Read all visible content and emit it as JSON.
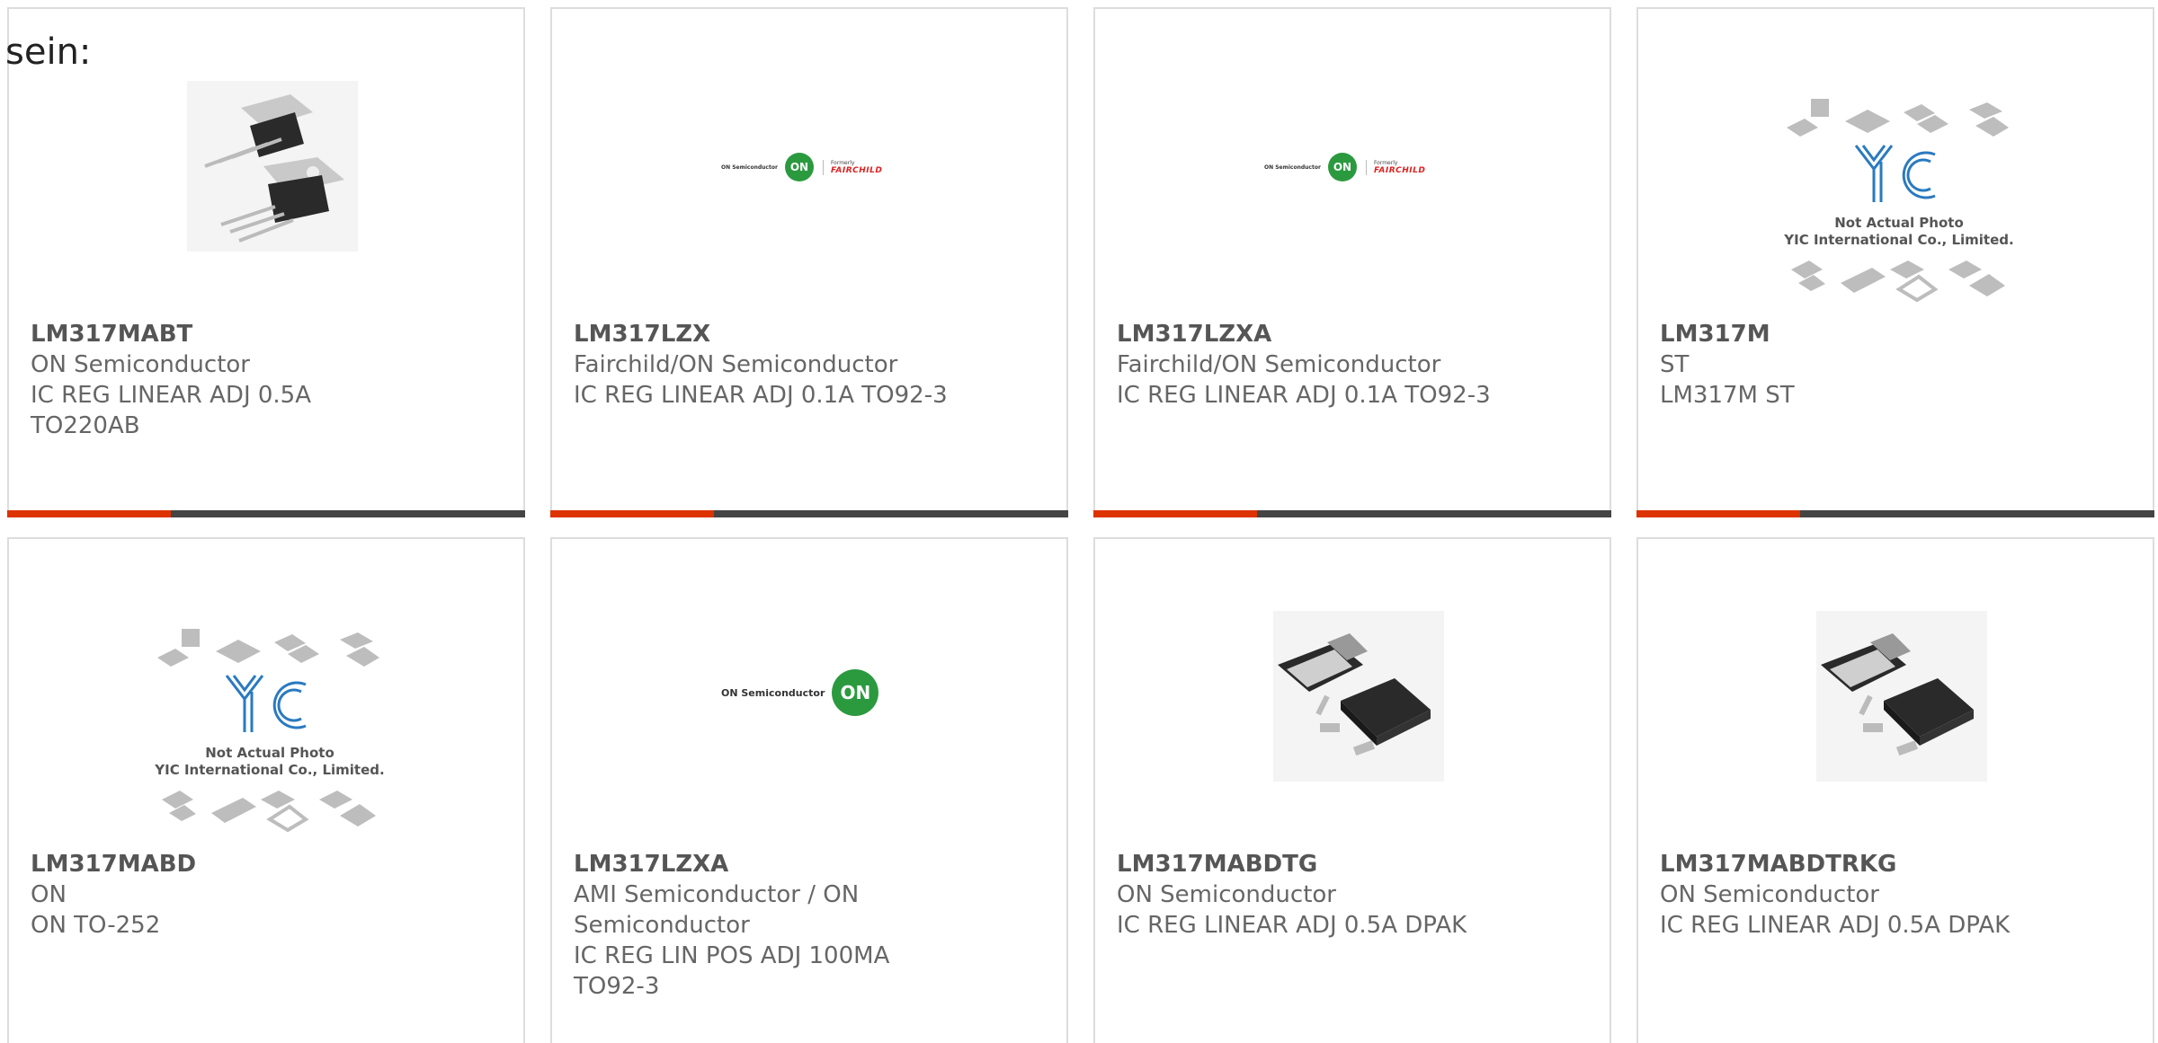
{
  "intro_text": "sein:",
  "products": [
    {
      "part": "LM317MABT",
      "manufacturer": "ON Semiconductor",
      "description": "IC REG LINEAR ADJ 0.5A TO220AB",
      "image": "to220-photo-icon"
    },
    {
      "part": "LM317LZX",
      "manufacturer": "Fairchild/ON Semiconductor",
      "description": "IC REG LINEAR ADJ 0.1A TO92-3",
      "image": "on-fairchild-logo"
    },
    {
      "part": "LM317LZXA",
      "manufacturer": "Fairchild/ON Semiconductor",
      "description": "IC REG LINEAR ADJ 0.1A TO92-3",
      "image": "on-fairchild-logo"
    },
    {
      "part": "LM317M",
      "manufacturer": "ST",
      "description": "LM317M ST",
      "image": "yic-placeholder-icon"
    },
    {
      "part": "LM317MABD",
      "manufacturer": "ON",
      "description": "ON TO-252",
      "image": "yic-placeholder-icon"
    },
    {
      "part": "LM317LZXA",
      "manufacturer": "AMI Semiconductor / ON Semiconductor",
      "description": "IC REG LIN POS ADJ 100MA TO92-3",
      "image": "on-semiconductor-logo"
    },
    {
      "part": "LM317MABDTG",
      "manufacturer": "ON Semiconductor",
      "description": "IC REG LINEAR ADJ 0.5A DPAK",
      "image": "dpak-photo-icon"
    },
    {
      "part": "LM317MABDTRKG",
      "manufacturer": "ON Semiconductor",
      "description": "IC REG LINEAR ADJ 0.5A DPAK",
      "image": "dpak-photo-icon"
    }
  ],
  "logos": {
    "on_semiconductor": "ON Semiconductor",
    "on_short": "ON",
    "formerly": "Formerly",
    "fairchild": "FAIRCHILD",
    "yic_mark": "YIC",
    "yic_line1": "Not Actual Photo",
    "yic_line2": "YIC International Co., Limited."
  },
  "colors": {
    "accent": "#dd3300",
    "bar": "#444444",
    "text": "#666666",
    "border": "#dddddd"
  }
}
